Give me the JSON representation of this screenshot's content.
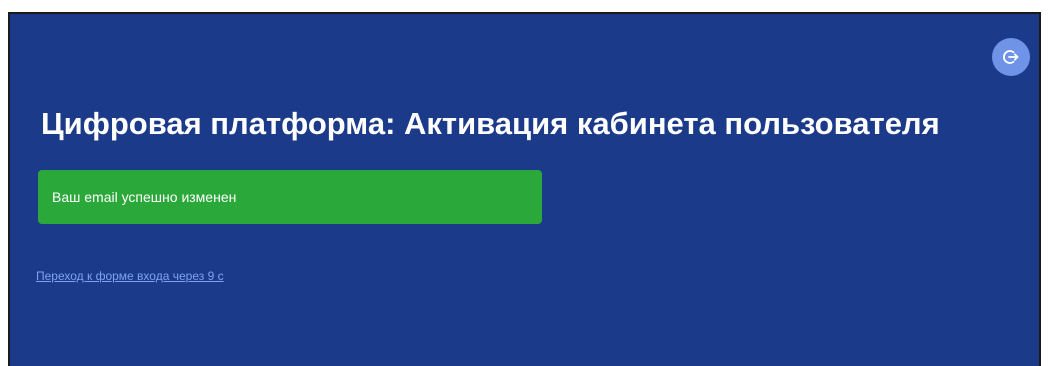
{
  "header": {
    "logout_icon": "logout-icon",
    "title": "Цифровая платформа: Активация кабинета пользователя"
  },
  "alert": {
    "message": "Ваш email успешно изменен",
    "color": "#2ba83a"
  },
  "redirect": {
    "link_text": "Переход к форме входа через 9 с"
  },
  "colors": {
    "background": "#1c3a8a",
    "logout_button": "#6f93e6",
    "link": "#7fa2f0"
  }
}
